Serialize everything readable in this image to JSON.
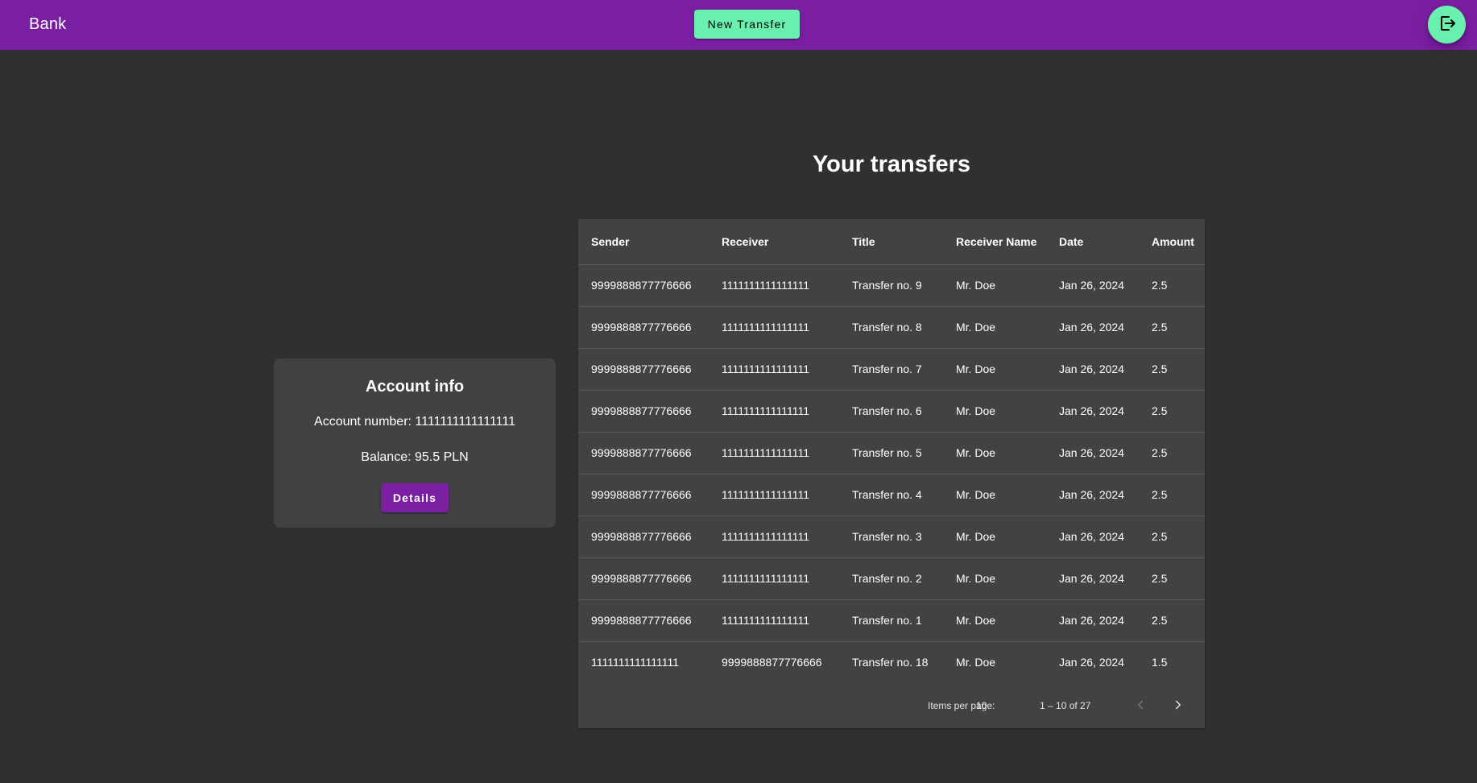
{
  "toolbar": {
    "brand": "Bank",
    "new_transfer_label": "New Transfer",
    "logout_icon": "logout-icon"
  },
  "account_card": {
    "title": "Account info",
    "account_number": "Account number: 1111111111111111",
    "balance": "Balance: 95.5 PLN",
    "details_label": "Details"
  },
  "page": {
    "title": "Your transfers"
  },
  "table": {
    "headers": [
      "Sender",
      "Receiver",
      "Title",
      "Receiver Name",
      "Date",
      "Amount"
    ],
    "rows": [
      [
        "9999888877776666",
        "1111111111111111",
        "Transfer no. 9",
        "Mr. Doe",
        "Jan 26, 2024",
        "2.5"
      ],
      [
        "9999888877776666",
        "1111111111111111",
        "Transfer no. 8",
        "Mr. Doe",
        "Jan 26, 2024",
        "2.5"
      ],
      [
        "9999888877776666",
        "1111111111111111",
        "Transfer no. 7",
        "Mr. Doe",
        "Jan 26, 2024",
        "2.5"
      ],
      [
        "9999888877776666",
        "1111111111111111",
        "Transfer no. 6",
        "Mr. Doe",
        "Jan 26, 2024",
        "2.5"
      ],
      [
        "9999888877776666",
        "1111111111111111",
        "Transfer no. 5",
        "Mr. Doe",
        "Jan 26, 2024",
        "2.5"
      ],
      [
        "9999888877776666",
        "1111111111111111",
        "Transfer no. 4",
        "Mr. Doe",
        "Jan 26, 2024",
        "2.5"
      ],
      [
        "9999888877776666",
        "1111111111111111",
        "Transfer no. 3",
        "Mr. Doe",
        "Jan 26, 2024",
        "2.5"
      ],
      [
        "9999888877776666",
        "1111111111111111",
        "Transfer no. 2",
        "Mr. Doe",
        "Jan 26, 2024",
        "2.5"
      ],
      [
        "9999888877776666",
        "1111111111111111",
        "Transfer no. 1",
        "Mr. Doe",
        "Jan 26, 2024",
        "2.5"
      ],
      [
        "1111111111111111",
        "9999888877776666",
        "Transfer no. 18",
        "Mr. Doe",
        "Jan 26, 2024",
        "1.5"
      ]
    ]
  },
  "paginator": {
    "items_per_page_label": "Items per page:",
    "page_size": "10",
    "range": "1 – 10 of 27"
  },
  "colors": {
    "primary": "#7b1fa2",
    "accent": "#69f0ae",
    "background": "#303030",
    "surface": "#424242"
  }
}
